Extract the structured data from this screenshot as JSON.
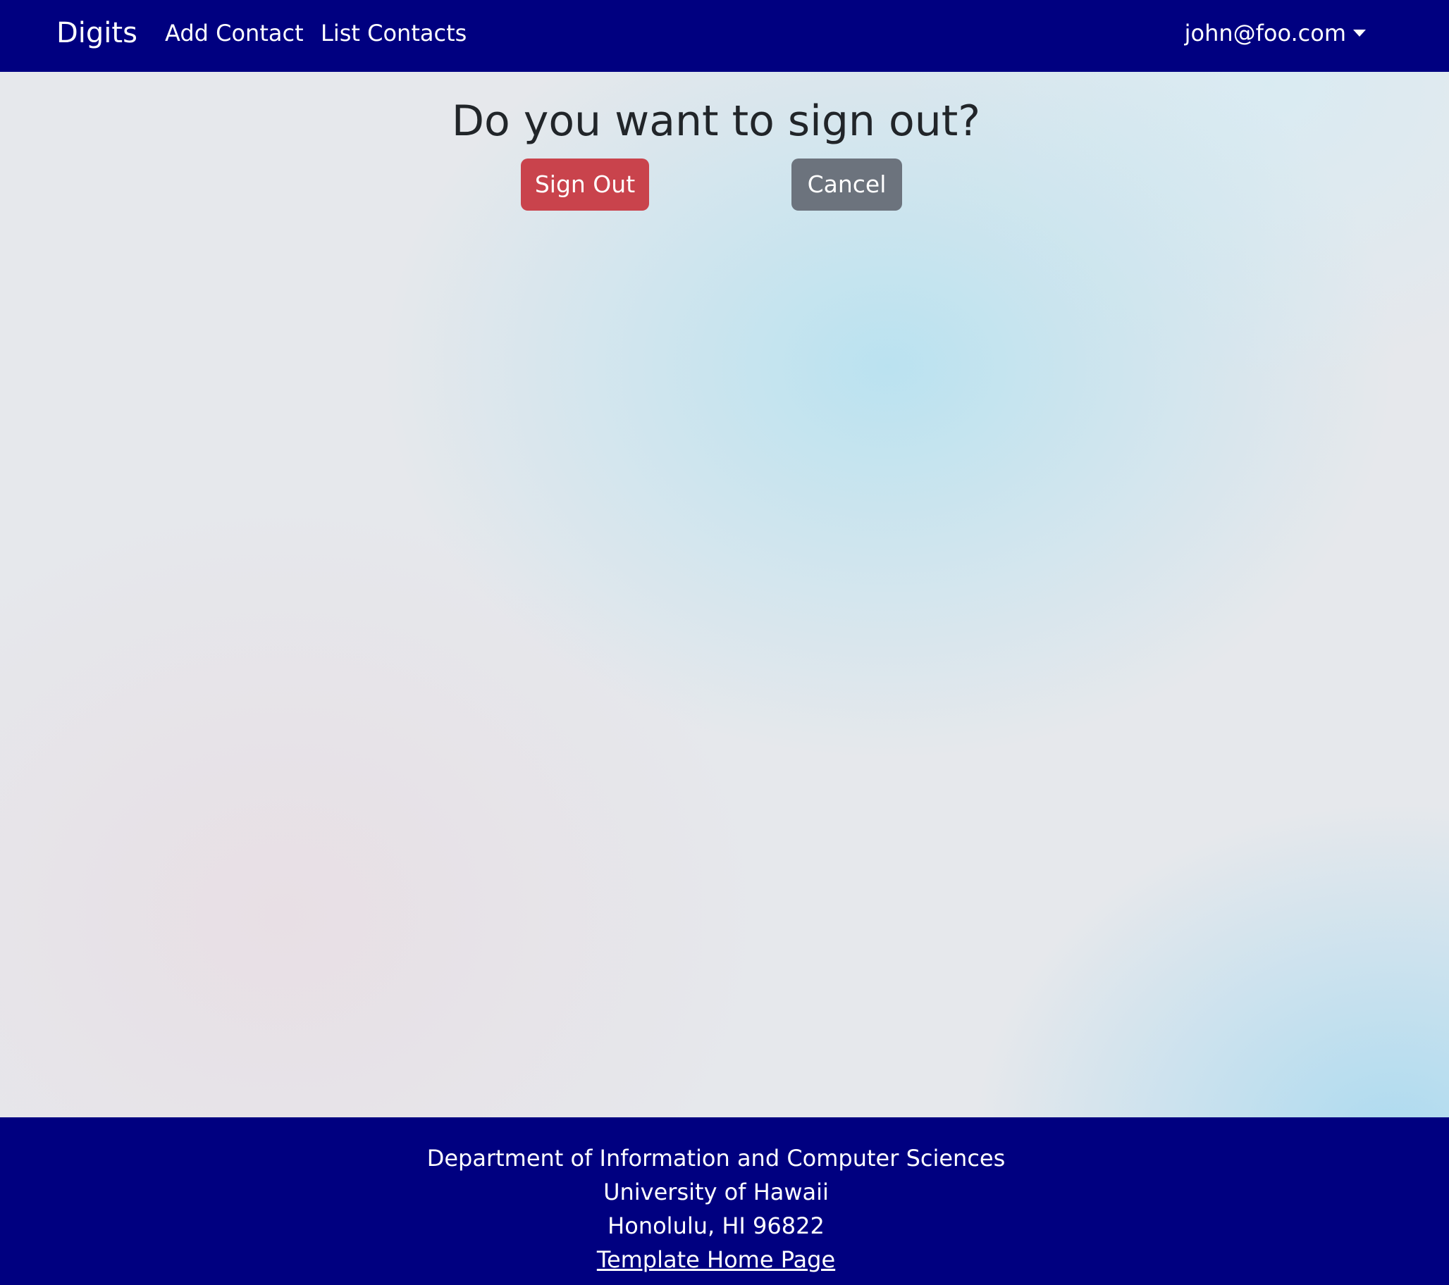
{
  "navbar": {
    "brand": "Digits",
    "links": [
      {
        "label": "Add Contact"
      },
      {
        "label": "List Contacts"
      }
    ],
    "user": {
      "email": "john@foo.com",
      "caret_icon": "caret-down-icon"
    },
    "background_color": "#000080"
  },
  "main": {
    "title": "Do you want to sign out?",
    "sign_out_label": "Sign Out",
    "cancel_label": "Cancel",
    "sign_out_color": "#c9434c",
    "cancel_color": "#6c737d"
  },
  "footer": {
    "lines": [
      "Department of Information and Computer Sciences",
      "University of Hawaii",
      "Honolulu, HI 96822"
    ],
    "link_label": "Template Home Page",
    "background_color": "#000080"
  }
}
